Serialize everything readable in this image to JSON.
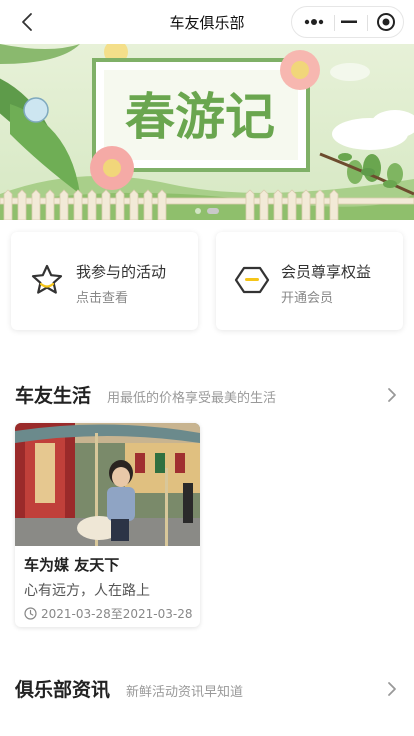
{
  "navbar": {
    "title": "车友俱乐部",
    "back_icon": "chevron-left-icon",
    "more_icon": "more-dots-icon",
    "minimize_icon": "minimize-icon",
    "close_icon": "target-circle-icon"
  },
  "banner": {
    "headline": "春游记",
    "slide_count": 2,
    "active_slide": 2
  },
  "cards": [
    {
      "title": "我参与的活动",
      "subtitle": "点击查看",
      "icon": "star-icon"
    },
    {
      "title": "会员尊享权益",
      "subtitle": "开通会员",
      "icon": "hexagon-badge-icon"
    }
  ],
  "sections": {
    "life": {
      "title": "车友生活",
      "subtitle": "用最低的价格享受最美的生活"
    },
    "news": {
      "title": "俱乐部资讯",
      "subtitle": "新鲜活动资讯早知道"
    }
  },
  "activity": {
    "title": "车为媒 友天下",
    "desc": "心有远方，人在路上",
    "date": "2021-03-28至2021-03-28"
  },
  "colors": {
    "accent_yellow": "#f5c518",
    "icon_dark": "#333333"
  }
}
